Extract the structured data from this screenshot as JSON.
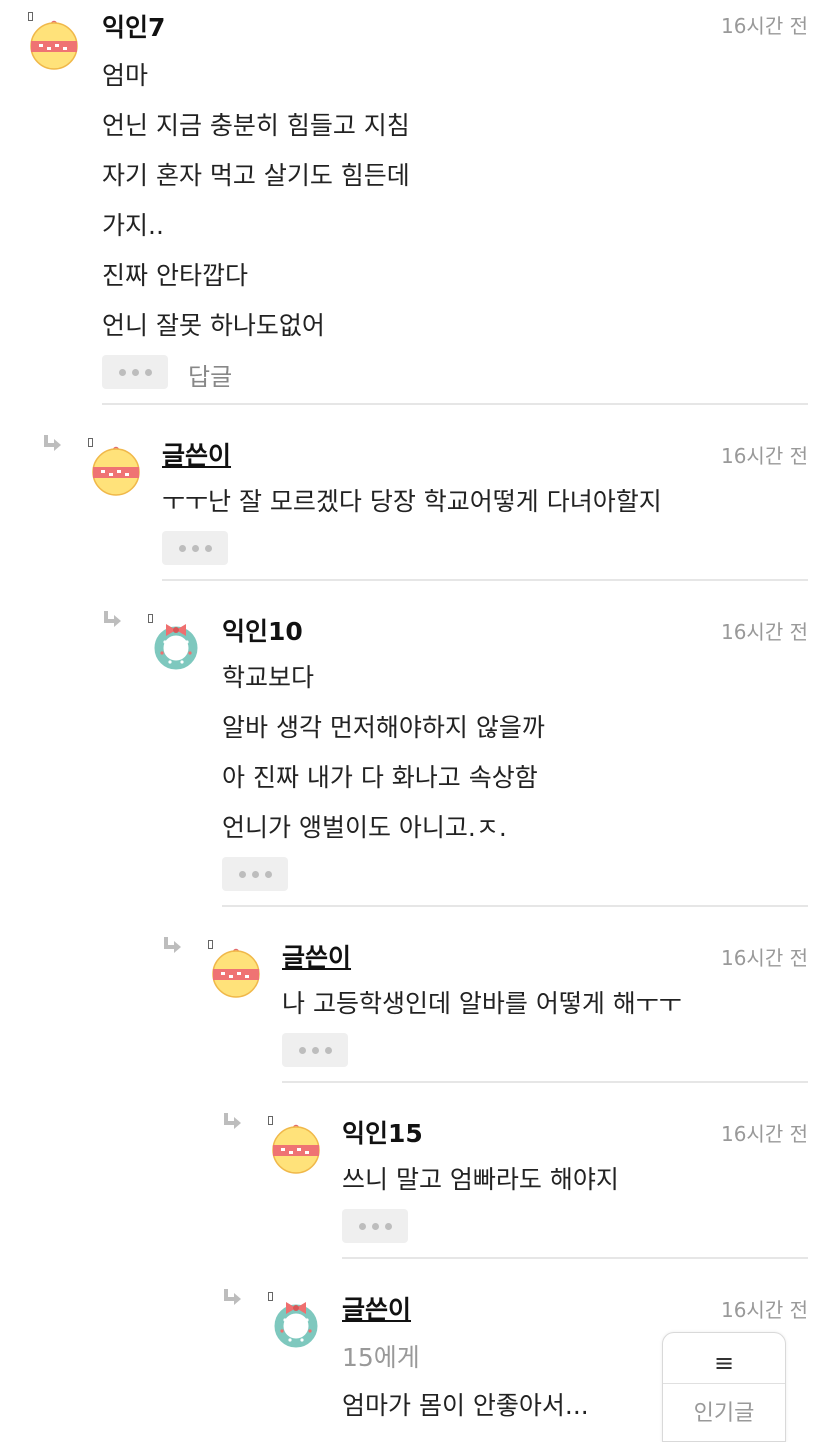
{
  "comments": [
    {
      "name": "익인7",
      "time": "16시간 전",
      "avatar": "ornament",
      "lines": [
        "엄마",
        "언닌 지금 충분히 힘들고 지침",
        "자기 혼자 먹고 살기도 힘든데",
        "가지..",
        "진짜 안타깝다",
        "언니 잘못 하나도없어"
      ],
      "reply_label": "답글"
    },
    {
      "name": "글쓴이",
      "time": "16시간 전",
      "avatar": "ornament",
      "lines": [
        "ㅜㅜ난 잘 모르겠다 당장 학교어떻게 다녀아할지"
      ]
    },
    {
      "name": "익인10",
      "time": "16시간 전",
      "avatar": "wreath",
      "lines": [
        "학교보다",
        "알바 생각 먼저해야하지 않을까",
        "아 진짜 내가 다 화나고 속상함",
        "언니가 앵벌이도 아니고.ㅈ."
      ]
    },
    {
      "name": "글쓴이",
      "time": "16시간 전",
      "avatar": "ornament",
      "lines": [
        "나 고등학생인데 알바를 어떻게 해ㅜㅜ"
      ]
    },
    {
      "name": "익인15",
      "time": "16시간 전",
      "avatar": "ornament",
      "lines": [
        "쓰니 말고 엄빠라도 해야지"
      ]
    },
    {
      "name": "글쓴이",
      "time": "16시간 전",
      "avatar": "wreath",
      "mention": "15에게",
      "lines": [
        "엄마가 몸이 안좋아서..."
      ]
    }
  ],
  "floating_menu": {
    "icon": "≡",
    "label": "인기글"
  },
  "colors": {
    "ornament_yellow": "#ffe27a",
    "ornament_red": "#ef7373",
    "wreath_green": "#7ec8be",
    "wreath_bow": "#ef6f6f"
  }
}
